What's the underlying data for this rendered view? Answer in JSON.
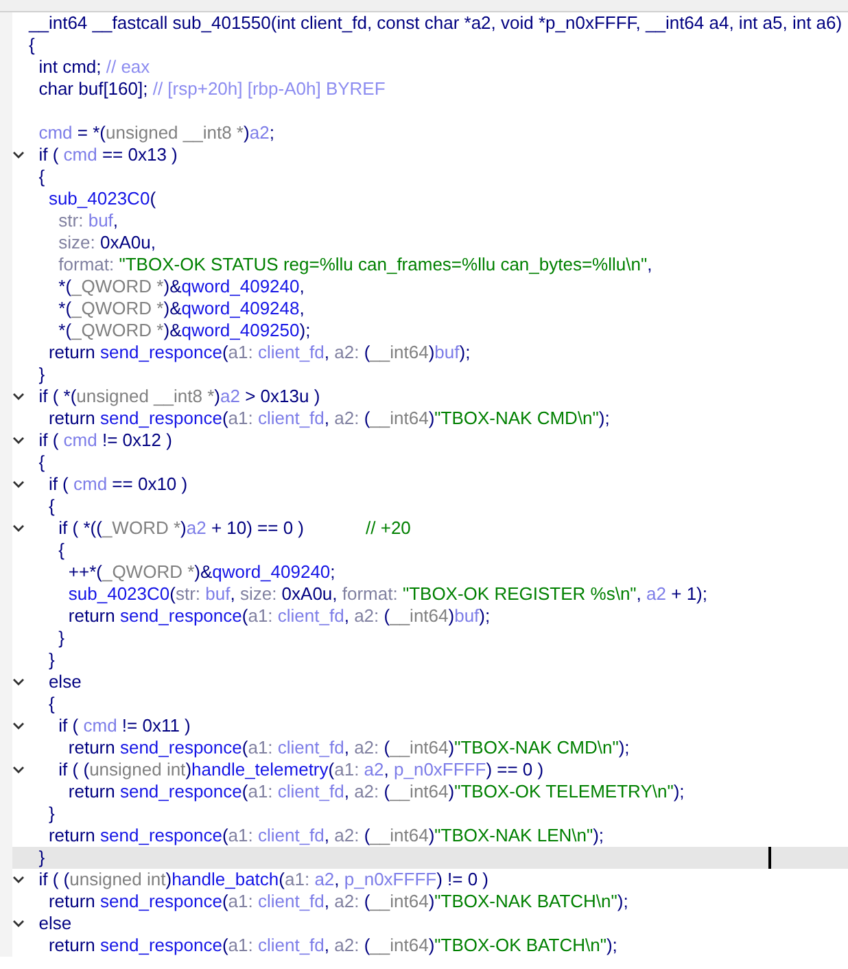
{
  "lines": [
    {
      "foldable": false,
      "current": false,
      "tokens": [
        {
          "kind": "plain",
          "text": "__int64 __fastcall sub_401550(int client_fd, const char *a2, void *p_n0xFFFF, __int64 a4, int a5, int a6)"
        }
      ]
    },
    {
      "foldable": false,
      "current": false,
      "tokens": [
        {
          "kind": "plain",
          "text": "{"
        }
      ]
    },
    {
      "foldable": false,
      "current": false,
      "tokens": [
        {
          "kind": "plain",
          "text": "  int cmd; "
        },
        {
          "kind": "comment",
          "text": "// eax"
        }
      ]
    },
    {
      "foldable": false,
      "current": false,
      "tokens": [
        {
          "kind": "plain",
          "text": "  char buf[160]; "
        },
        {
          "kind": "comment",
          "text": "// [rsp+20h] [rbp-A0h] BYREF"
        }
      ]
    },
    {
      "foldable": false,
      "current": false
    },
    {
      "foldable": false,
      "current": false,
      "tokens": [
        {
          "kind": "var",
          "text": "  cmd"
        },
        {
          "kind": "plain",
          "text": " = *("
        },
        {
          "kind": "type",
          "text": "unsigned __int8 *"
        },
        {
          "kind": "plain",
          "text": ")"
        },
        {
          "kind": "var",
          "text": "a2"
        },
        {
          "kind": "plain",
          "text": ";"
        }
      ]
    },
    {
      "foldable": true,
      "current": false,
      "tokens": [
        {
          "kind": "plain",
          "text": "  if ( "
        },
        {
          "kind": "var",
          "text": "cmd"
        },
        {
          "kind": "plain",
          "text": " == 0x13 )"
        }
      ]
    },
    {
      "foldable": false,
      "current": false,
      "tokens": [
        {
          "kind": "plain",
          "text": "  {"
        }
      ]
    },
    {
      "foldable": false,
      "current": false,
      "tokens": [
        {
          "kind": "func",
          "text": "    sub_4023C0"
        },
        {
          "kind": "plain",
          "text": "("
        }
      ]
    },
    {
      "foldable": false,
      "current": false,
      "tokens": [
        {
          "kind": "label",
          "text": "      str: "
        },
        {
          "kind": "var",
          "text": "buf"
        },
        {
          "kind": "plain",
          "text": ","
        }
      ]
    },
    {
      "foldable": false,
      "current": false,
      "tokens": [
        {
          "kind": "label",
          "text": "      size: "
        },
        {
          "kind": "plain",
          "text": "0xA0u,"
        }
      ]
    },
    {
      "foldable": false,
      "current": false,
      "tokens": [
        {
          "kind": "label",
          "text": "      format: "
        },
        {
          "kind": "str",
          "text": "\"TBOX-OK STATUS reg=%llu can_frames=%llu can_bytes=%llu\\n\""
        },
        {
          "kind": "plain",
          "text": ","
        }
      ]
    },
    {
      "foldable": false,
      "current": false,
      "tokens": [
        {
          "kind": "plain",
          "text": "      *("
        },
        {
          "kind": "type",
          "text": "_QWORD *"
        },
        {
          "kind": "plain",
          "text": ")&"
        },
        {
          "kind": "func",
          "text": "qword_409240"
        },
        {
          "kind": "plain",
          "text": ","
        }
      ]
    },
    {
      "foldable": false,
      "current": false,
      "tokens": [
        {
          "kind": "plain",
          "text": "      *("
        },
        {
          "kind": "type",
          "text": "_QWORD *"
        },
        {
          "kind": "plain",
          "text": ")&"
        },
        {
          "kind": "func",
          "text": "qword_409248"
        },
        {
          "kind": "plain",
          "text": ","
        }
      ]
    },
    {
      "foldable": false,
      "current": false,
      "tokens": [
        {
          "kind": "plain",
          "text": "      *("
        },
        {
          "kind": "type",
          "text": "_QWORD *"
        },
        {
          "kind": "plain",
          "text": ")&"
        },
        {
          "kind": "func",
          "text": "qword_409250"
        },
        {
          "kind": "plain",
          "text": ");"
        }
      ]
    },
    {
      "foldable": false,
      "current": false,
      "tokens": [
        {
          "kind": "plain",
          "text": "    return "
        },
        {
          "kind": "func",
          "text": "send_responce"
        },
        {
          "kind": "plain",
          "text": "("
        },
        {
          "kind": "label",
          "text": "a1: "
        },
        {
          "kind": "var",
          "text": "client_fd"
        },
        {
          "kind": "plain",
          "text": ", "
        },
        {
          "kind": "label",
          "text": "a2: "
        },
        {
          "kind": "plain",
          "text": "("
        },
        {
          "kind": "type",
          "text": "__int64"
        },
        {
          "kind": "plain",
          "text": ")"
        },
        {
          "kind": "var",
          "text": "buf"
        },
        {
          "kind": "plain",
          "text": ");"
        }
      ]
    },
    {
      "foldable": false,
      "current": false,
      "tokens": [
        {
          "kind": "plain",
          "text": "  }"
        }
      ]
    },
    {
      "foldable": true,
      "current": false,
      "tokens": [
        {
          "kind": "plain",
          "text": "  if ( *("
        },
        {
          "kind": "type",
          "text": "unsigned __int8 *"
        },
        {
          "kind": "plain",
          "text": ")"
        },
        {
          "kind": "var",
          "text": "a2"
        },
        {
          "kind": "plain",
          "text": " > 0x13u )"
        }
      ]
    },
    {
      "foldable": false,
      "current": false,
      "tokens": [
        {
          "kind": "plain",
          "text": "    return "
        },
        {
          "kind": "func",
          "text": "send_responce"
        },
        {
          "kind": "plain",
          "text": "("
        },
        {
          "kind": "label",
          "text": "a1: "
        },
        {
          "kind": "var",
          "text": "client_fd"
        },
        {
          "kind": "plain",
          "text": ", "
        },
        {
          "kind": "label",
          "text": "a2: "
        },
        {
          "kind": "plain",
          "text": "("
        },
        {
          "kind": "type",
          "text": "__int64"
        },
        {
          "kind": "plain",
          "text": ")"
        },
        {
          "kind": "str",
          "text": "\"TBOX-NAK CMD\\n\""
        },
        {
          "kind": "plain",
          "text": ");"
        }
      ]
    },
    {
      "foldable": true,
      "current": false,
      "tokens": [
        {
          "kind": "plain",
          "text": "  if ( "
        },
        {
          "kind": "var",
          "text": "cmd"
        },
        {
          "kind": "plain",
          "text": " != 0x12 )"
        }
      ]
    },
    {
      "foldable": false,
      "current": false,
      "tokens": [
        {
          "kind": "plain",
          "text": "  {"
        }
      ]
    },
    {
      "foldable": true,
      "current": false,
      "tokens": [
        {
          "kind": "plain",
          "text": "    if ( "
        },
        {
          "kind": "var",
          "text": "cmd"
        },
        {
          "kind": "plain",
          "text": " == 0x10 )"
        }
      ]
    },
    {
      "foldable": false,
      "current": false,
      "tokens": [
        {
          "kind": "plain",
          "text": "    {"
        }
      ]
    },
    {
      "foldable": true,
      "current": false,
      "tokens": [
        {
          "kind": "plain",
          "text": "      if ( *(("
        },
        {
          "kind": "type",
          "text": "_WORD *"
        },
        {
          "kind": "plain",
          "text": ")"
        },
        {
          "kind": "var",
          "text": "a2"
        },
        {
          "kind": "plain",
          "text": " + 10) == 0 )"
        },
        {
          "kind": "note",
          "text": "// +20"
        }
      ]
    },
    {
      "foldable": false,
      "current": false,
      "tokens": [
        {
          "kind": "plain",
          "text": "      {"
        }
      ]
    },
    {
      "foldable": false,
      "current": false,
      "tokens": [
        {
          "kind": "plain",
          "text": "        ++*("
        },
        {
          "kind": "type",
          "text": "_QWORD *"
        },
        {
          "kind": "plain",
          "text": ")&"
        },
        {
          "kind": "func",
          "text": "qword_409240"
        },
        {
          "kind": "plain",
          "text": ";"
        }
      ]
    },
    {
      "foldable": false,
      "current": false,
      "tokens": [
        {
          "kind": "func",
          "text": "        sub_4023C0"
        },
        {
          "kind": "plain",
          "text": "("
        },
        {
          "kind": "label",
          "text": "str: "
        },
        {
          "kind": "var",
          "text": "buf"
        },
        {
          "kind": "plain",
          "text": ", "
        },
        {
          "kind": "label",
          "text": "size: "
        },
        {
          "kind": "plain",
          "text": "0xA0u, "
        },
        {
          "kind": "label",
          "text": "format: "
        },
        {
          "kind": "str",
          "text": "\"TBOX-OK REGISTER %s\\n\""
        },
        {
          "kind": "plain",
          "text": ", "
        },
        {
          "kind": "var",
          "text": "a2"
        },
        {
          "kind": "plain",
          "text": " + 1);"
        }
      ]
    },
    {
      "foldable": false,
      "current": false,
      "tokens": [
        {
          "kind": "plain",
          "text": "        return "
        },
        {
          "kind": "func",
          "text": "send_responce"
        },
        {
          "kind": "plain",
          "text": "("
        },
        {
          "kind": "label",
          "text": "a1: "
        },
        {
          "kind": "var",
          "text": "client_fd"
        },
        {
          "kind": "plain",
          "text": ", "
        },
        {
          "kind": "label",
          "text": "a2: "
        },
        {
          "kind": "plain",
          "text": "("
        },
        {
          "kind": "type",
          "text": "__int64"
        },
        {
          "kind": "plain",
          "text": ")"
        },
        {
          "kind": "var",
          "text": "buf"
        },
        {
          "kind": "plain",
          "text": ");"
        }
      ]
    },
    {
      "foldable": false,
      "current": false,
      "tokens": [
        {
          "kind": "plain",
          "text": "      }"
        }
      ]
    },
    {
      "foldable": false,
      "current": false,
      "tokens": [
        {
          "kind": "plain",
          "text": "    }"
        }
      ]
    },
    {
      "foldable": true,
      "current": false,
      "tokens": [
        {
          "kind": "plain",
          "text": "    else"
        }
      ]
    },
    {
      "foldable": false,
      "current": false,
      "tokens": [
        {
          "kind": "plain",
          "text": "    {"
        }
      ]
    },
    {
      "foldable": true,
      "current": false,
      "tokens": [
        {
          "kind": "plain",
          "text": "      if ( "
        },
        {
          "kind": "var",
          "text": "cmd"
        },
        {
          "kind": "plain",
          "text": " != 0x11 )"
        }
      ]
    },
    {
      "foldable": false,
      "current": false,
      "tokens": [
        {
          "kind": "plain",
          "text": "        return "
        },
        {
          "kind": "func",
          "text": "send_responce"
        },
        {
          "kind": "plain",
          "text": "("
        },
        {
          "kind": "label",
          "text": "a1: "
        },
        {
          "kind": "var",
          "text": "client_fd"
        },
        {
          "kind": "plain",
          "text": ", "
        },
        {
          "kind": "label",
          "text": "a2: "
        },
        {
          "kind": "plain",
          "text": "("
        },
        {
          "kind": "type",
          "text": "__int64"
        },
        {
          "kind": "plain",
          "text": ")"
        },
        {
          "kind": "str",
          "text": "\"TBOX-NAK CMD\\n\""
        },
        {
          "kind": "plain",
          "text": ");"
        }
      ]
    },
    {
      "foldable": true,
      "current": false,
      "tokens": [
        {
          "kind": "plain",
          "text": "      if ( ("
        },
        {
          "kind": "type",
          "text": "unsigned int"
        },
        {
          "kind": "plain",
          "text": ")"
        },
        {
          "kind": "func",
          "text": "handle_telemetry"
        },
        {
          "kind": "plain",
          "text": "("
        },
        {
          "kind": "label",
          "text": "a1: "
        },
        {
          "kind": "var",
          "text": "a2"
        },
        {
          "kind": "plain",
          "text": ", "
        },
        {
          "kind": "var",
          "text": "p_n0xFFFF"
        },
        {
          "kind": "plain",
          "text": ") == 0 )"
        }
      ]
    },
    {
      "foldable": false,
      "current": false,
      "tokens": [
        {
          "kind": "plain",
          "text": "        return "
        },
        {
          "kind": "func",
          "text": "send_responce"
        },
        {
          "kind": "plain",
          "text": "("
        },
        {
          "kind": "label",
          "text": "a1: "
        },
        {
          "kind": "var",
          "text": "client_fd"
        },
        {
          "kind": "plain",
          "text": ", "
        },
        {
          "kind": "label",
          "text": "a2: "
        },
        {
          "kind": "plain",
          "text": "("
        },
        {
          "kind": "type",
          "text": "__int64"
        },
        {
          "kind": "plain",
          "text": ")"
        },
        {
          "kind": "str",
          "text": "\"TBOX-OK TELEMETRY\\n\""
        },
        {
          "kind": "plain",
          "text": ");"
        }
      ]
    },
    {
      "foldable": false,
      "current": false,
      "tokens": [
        {
          "kind": "plain",
          "text": "    }"
        }
      ]
    },
    {
      "foldable": false,
      "current": false,
      "tokens": [
        {
          "kind": "plain",
          "text": "    return "
        },
        {
          "kind": "func",
          "text": "send_responce"
        },
        {
          "kind": "plain",
          "text": "("
        },
        {
          "kind": "label",
          "text": "a1: "
        },
        {
          "kind": "var",
          "text": "client_fd"
        },
        {
          "kind": "plain",
          "text": ", "
        },
        {
          "kind": "label",
          "text": "a2: "
        },
        {
          "kind": "plain",
          "text": "("
        },
        {
          "kind": "type",
          "text": "__int64"
        },
        {
          "kind": "plain",
          "text": ")"
        },
        {
          "kind": "str",
          "text": "\"TBOX-NAK LEN\\n\""
        },
        {
          "kind": "plain",
          "text": ");"
        }
      ]
    },
    {
      "foldable": false,
      "current": true,
      "tokens": [
        {
          "kind": "plain",
          "text": "  }"
        }
      ]
    },
    {
      "foldable": true,
      "current": false,
      "tokens": [
        {
          "kind": "plain",
          "text": "  if ( ("
        },
        {
          "kind": "type",
          "text": "unsigned int"
        },
        {
          "kind": "plain",
          "text": ")"
        },
        {
          "kind": "func",
          "text": "handle_batch"
        },
        {
          "kind": "plain",
          "text": "("
        },
        {
          "kind": "label",
          "text": "a1: "
        },
        {
          "kind": "var",
          "text": "a2"
        },
        {
          "kind": "plain",
          "text": ", "
        },
        {
          "kind": "var",
          "text": "p_n0xFFFF"
        },
        {
          "kind": "plain",
          "text": ") != 0 )"
        }
      ]
    },
    {
      "foldable": false,
      "current": false,
      "tokens": [
        {
          "kind": "plain",
          "text": "    return "
        },
        {
          "kind": "func",
          "text": "send_responce"
        },
        {
          "kind": "plain",
          "text": "("
        },
        {
          "kind": "label",
          "text": "a1: "
        },
        {
          "kind": "var",
          "text": "client_fd"
        },
        {
          "kind": "plain",
          "text": ", "
        },
        {
          "kind": "label",
          "text": "a2: "
        },
        {
          "kind": "plain",
          "text": "("
        },
        {
          "kind": "type",
          "text": "__int64"
        },
        {
          "kind": "plain",
          "text": ")"
        },
        {
          "kind": "str",
          "text": "\"TBOX-NAK BATCH\\n\""
        },
        {
          "kind": "plain",
          "text": ");"
        }
      ]
    },
    {
      "foldable": true,
      "current": false,
      "tokens": [
        {
          "kind": "plain",
          "text": "  else"
        }
      ]
    },
    {
      "foldable": false,
      "current": false,
      "tokens": [
        {
          "kind": "plain",
          "text": "    return "
        },
        {
          "kind": "func",
          "text": "send_responce"
        },
        {
          "kind": "plain",
          "text": "("
        },
        {
          "kind": "label",
          "text": "a1: "
        },
        {
          "kind": "var",
          "text": "client_fd"
        },
        {
          "kind": "plain",
          "text": ", "
        },
        {
          "kind": "label",
          "text": "a2: "
        },
        {
          "kind": "plain",
          "text": "("
        },
        {
          "kind": "type",
          "text": "__int64"
        },
        {
          "kind": "plain",
          "text": ")"
        },
        {
          "kind": "str",
          "text": "\"TBOX-OK BATCH\\n\""
        },
        {
          "kind": "plain",
          "text": ");"
        }
      ]
    }
  ]
}
